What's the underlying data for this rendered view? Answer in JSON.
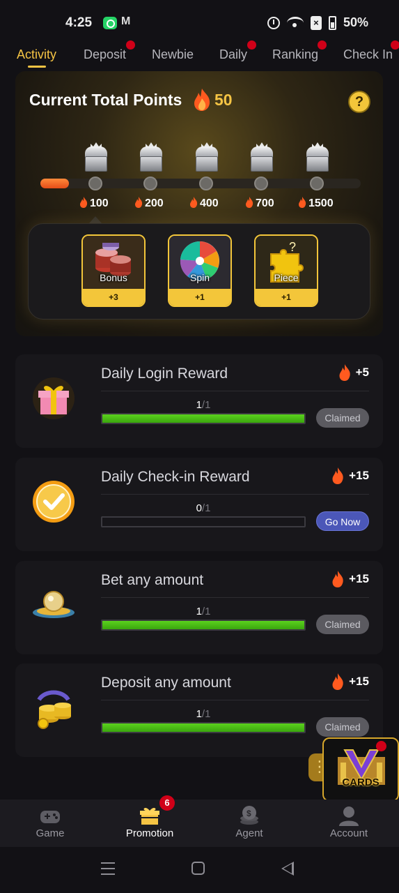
{
  "status_bar": {
    "time": "4:25",
    "battery": "50%",
    "icons": [
      "whatsapp-icon",
      "gmail-icon",
      "alarm-icon",
      "wifi-icon",
      "no-sim-icon",
      "battery-icon"
    ]
  },
  "tabs": [
    {
      "label": "Activity",
      "active": true,
      "dot": false
    },
    {
      "label": "Deposit",
      "active": false,
      "dot": true
    },
    {
      "label": "Newbie",
      "active": false,
      "dot": false
    },
    {
      "label": "Daily",
      "active": false,
      "dot": true
    },
    {
      "label": "Ranking",
      "active": false,
      "dot": true
    },
    {
      "label": "Check In",
      "active": false,
      "dot": true
    }
  ],
  "points_card": {
    "title": "Current Total Points",
    "points": "50",
    "help_icon": "?",
    "progress_fraction": 0.09,
    "milestones": [
      "100",
      "200",
      "400",
      "700",
      "1500"
    ],
    "rewards": [
      {
        "label": "Bonus",
        "count": "+3",
        "icon": "coin-stack-icon"
      },
      {
        "label": "Spin",
        "count": "+1",
        "icon": "prize-wheel-icon"
      },
      {
        "label": "Piece",
        "count": "+1",
        "icon": "puzzle-piece-icon"
      }
    ]
  },
  "tasks": [
    {
      "title": "Daily Login Reward",
      "reward": "+5",
      "done": "1",
      "total": "/1",
      "fraction": 1.0,
      "button": "Claimed",
      "icon": "gift-box-icon"
    },
    {
      "title": "Daily Check-in Reward",
      "reward": "+15",
      "done": "0",
      "total": "/1",
      "fraction": 0.0,
      "button": "Go Now",
      "icon": "checkmark-badge-icon"
    },
    {
      "title": "Bet any amount",
      "reward": "+15",
      "done": "1",
      "total": "/1",
      "fraction": 1.0,
      "button": "Claimed",
      "icon": "crystal-ball-hat-icon"
    },
    {
      "title": "Deposit any amount",
      "reward": "+15",
      "done": "1",
      "total": "/1",
      "fraction": 1.0,
      "button": "Claimed",
      "icon": "coin-stack-arrow-icon"
    }
  ],
  "floating_badge": {
    "label": "CARDS"
  },
  "bottom_nav": [
    {
      "label": "Game",
      "icon": "gamepad-icon",
      "active": false
    },
    {
      "label": "Promotion",
      "icon": "gift-icon",
      "active": true,
      "badge": "6"
    },
    {
      "label": "Agent",
      "icon": "coin-agent-icon",
      "active": false
    },
    {
      "label": "Account",
      "icon": "user-icon",
      "active": false
    }
  ],
  "colors": {
    "accent": "#f5c444",
    "background": "#121115",
    "progress_green": "#4fc21a",
    "go_button": "#4b57b8",
    "badge_red": "#d00018"
  }
}
